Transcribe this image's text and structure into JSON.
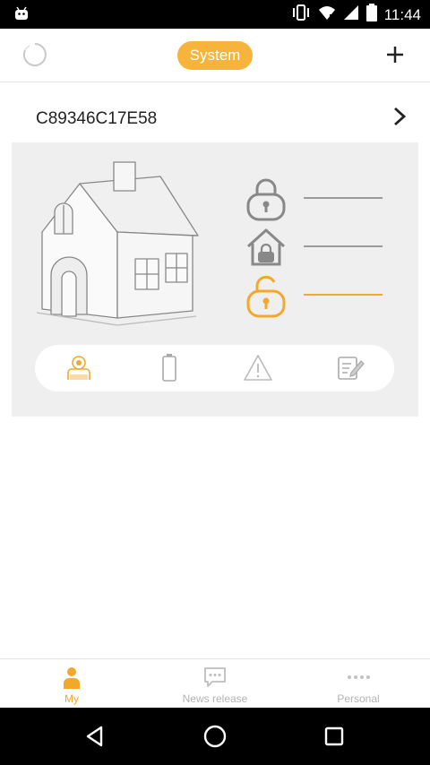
{
  "status_bar": {
    "time": "11:44",
    "icons": [
      "android-icon",
      "vibrate-icon",
      "wifi-icon",
      "signal-icon",
      "battery-icon"
    ]
  },
  "header": {
    "title": "System",
    "refresh_icon": "refresh-icon",
    "add_icon": "plus-icon"
  },
  "device": {
    "id": "C89346C17E58",
    "arrow_icon": "chevron-right-icon"
  },
  "panel": {
    "modes": [
      {
        "icon": "lock-closed-icon",
        "active": false
      },
      {
        "icon": "home-lock-icon",
        "active": false
      },
      {
        "icon": "lock-open-icon",
        "active": true
      }
    ],
    "quick_icons": [
      "sensor-icon",
      "battery-icon",
      "warning-icon",
      "log-icon"
    ]
  },
  "tabs": [
    {
      "label": "My",
      "icon": "person-icon",
      "active": true
    },
    {
      "label": "News release",
      "icon": "chat-icon",
      "active": false
    },
    {
      "label": "Personal",
      "icon": "more-icon",
      "active": false
    }
  ],
  "colors": {
    "accent": "#f2a92b",
    "pill": "#f7b43a",
    "panel_bg": "#efefef"
  }
}
